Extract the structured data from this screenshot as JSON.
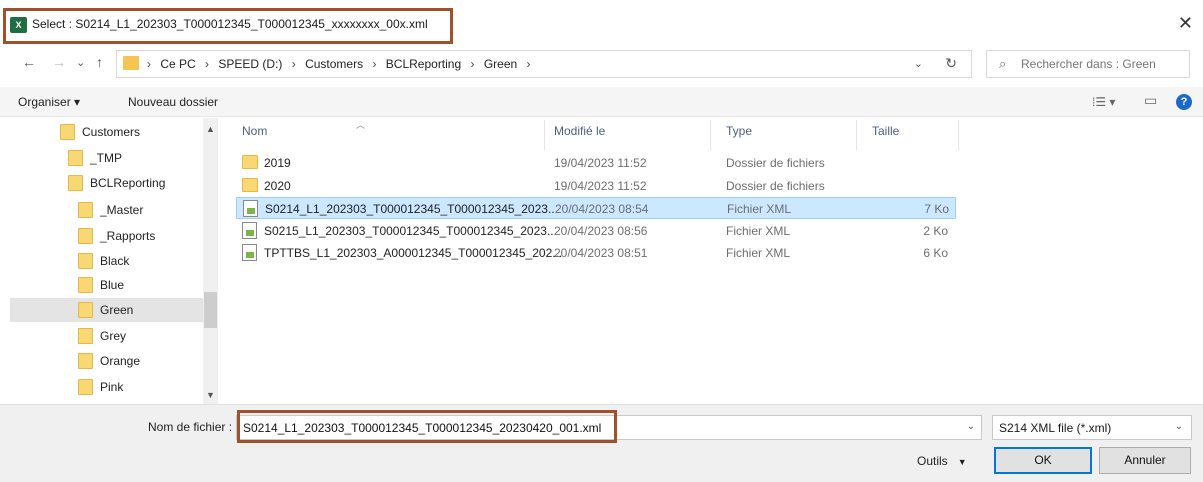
{
  "window": {
    "title": "Select : S0214_L1_202303_T000012345_T000012345_xxxxxxxx_00x.xml",
    "app_icon": "X",
    "close": "✕"
  },
  "nav": {
    "back": "←",
    "forward": "→",
    "recent": "⌄",
    "up": "↑",
    "breadcrumbs": [
      "Ce PC",
      "SPEED (D:)",
      "Customers",
      "BCLReporting",
      "Green"
    ],
    "separator": "›",
    "dropdown": "⌄",
    "refresh": "↻",
    "search_placeholder": "Rechercher dans : Green"
  },
  "commandbar": {
    "organize": "Organiser ▾",
    "new_folder": "Nouveau dossier",
    "view_options": "⁞☰ ▾",
    "preview_pane": "▭",
    "help": "?"
  },
  "sidebar": {
    "items": [
      {
        "label": "Customers"
      },
      {
        "label": "_TMP"
      },
      {
        "label": "BCLReporting"
      },
      {
        "label": "_Master"
      },
      {
        "label": "_Rapports"
      },
      {
        "label": "Black"
      },
      {
        "label": "Blue"
      },
      {
        "label": "Green"
      },
      {
        "label": "Grey"
      },
      {
        "label": "Orange"
      },
      {
        "label": "Pink"
      }
    ],
    "scroll_up": "▲",
    "scroll_down": "▼"
  },
  "filelist": {
    "columns": {
      "name": "Nom",
      "modified": "Modifié le",
      "type": "Type",
      "size": "Taille"
    },
    "rows": [
      {
        "name": "2019",
        "modified": "19/04/2023 11:52",
        "type": "Dossier de fichiers",
        "size": "",
        "kind": "folder"
      },
      {
        "name": "2020",
        "modified": "19/04/2023 11:52",
        "type": "Dossier de fichiers",
        "size": "",
        "kind": "folder"
      },
      {
        "name": "S0214_L1_202303_T000012345_T000012345_2023...",
        "modified": "20/04/2023 08:54",
        "type": "Fichier XML",
        "size": "7 Ko",
        "kind": "xml"
      },
      {
        "name": "S0215_L1_202303_T000012345_T000012345_2023...",
        "modified": "20/04/2023 08:56",
        "type": "Fichier XML",
        "size": "2 Ko",
        "kind": "xml"
      },
      {
        "name": "TPTTBS_L1_202303_A000012345_T000012345_202...",
        "modified": "20/04/2023 08:51",
        "type": "Fichier XML",
        "size": "6 Ko",
        "kind": "xml"
      }
    ]
  },
  "footer": {
    "filename_label": "Nom de fichier :",
    "filename_value": "S0214_L1_202303_T000012345_T000012345_20230420_001.xml",
    "filter_value": "S214 XML file  (*.xml)",
    "tools": "Outils",
    "ok": "OK",
    "cancel": "Annuler"
  },
  "colors": {
    "highlight_border": "#a0502a",
    "selection_bg": "#cce8ff",
    "excel_green": "#1d6f42"
  }
}
